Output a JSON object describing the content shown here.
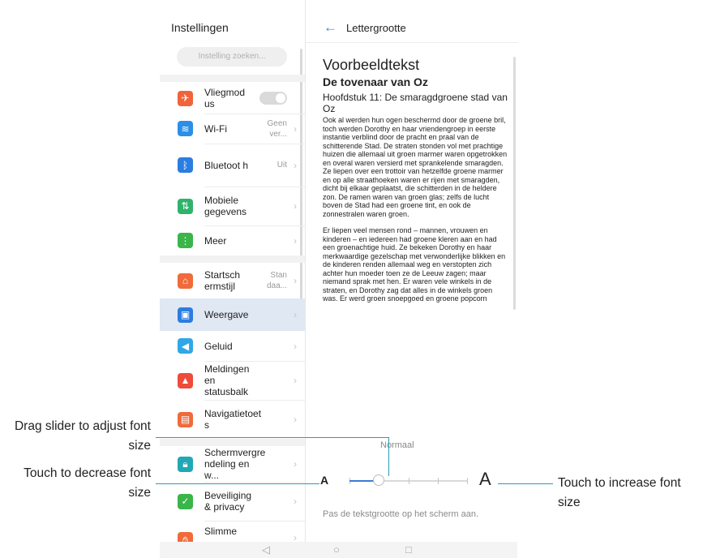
{
  "left_pane": {
    "title": "Instellingen",
    "search_placeholder": "Instelling zoeken...",
    "items": [
      {
        "label": "Vliegmod us",
        "value": "",
        "icon": "airplane-icon",
        "color": "#f0643c"
      },
      {
        "label": "Wi-Fi",
        "value": "Geen ver...",
        "icon": "wifi-icon",
        "color": "#2b8fe8"
      },
      {
        "label": "Bluetoot h",
        "value": "Uit",
        "icon": "bluetooth-icon",
        "color": "#2b7de0"
      },
      {
        "label": "Mobiele gegevens",
        "value": "",
        "icon": "mobile-data-icon",
        "color": "#2fb36b"
      },
      {
        "label": "Meer",
        "value": "",
        "icon": "more-icon",
        "color": "#39b54a"
      },
      {
        "label": "Startsch ermstijl",
        "value": "Stan daa...",
        "icon": "home-icon",
        "color": "#f06a3a"
      },
      {
        "label": "Weergave",
        "value": "",
        "icon": "display-icon",
        "color": "#2b7de0"
      },
      {
        "label": "Geluid",
        "value": "",
        "icon": "sound-icon",
        "color": "#30a7e6"
      },
      {
        "label": "Meldingen en statusbalk",
        "value": "",
        "icon": "notifications-icon",
        "color": "#ef4b3a"
      },
      {
        "label": "Navigatietoet s",
        "value": "",
        "icon": "navigation-keys-icon",
        "color": "#f06a3a"
      },
      {
        "label": "Schermvergre ndeling en w...",
        "value": "",
        "icon": "lock-icon",
        "color": "#21a7b5"
      },
      {
        "label": "Beveiliging & privacy",
        "value": "",
        "icon": "shield-icon",
        "color": "#39b54a"
      },
      {
        "label": "Slimme",
        "value": "",
        "icon": "hand-icon",
        "color": "#f06a3a"
      }
    ]
  },
  "right_pane": {
    "title": "Lettergrootte",
    "preview_heading": "Voorbeeldtekst",
    "book_title": "De tovenaar van Oz",
    "chapter": "Hoofdstuk 11: De smaragdgroene stad van Oz",
    "paragraph1": "Ook al werden hun ogen beschermd door de groene bril, toch werden Dorothy en haar vriendengroep in eerste instantie verblind door de pracht en praal van de schitterende Stad. De straten stonden vol met prachtige huizen die allemaal uit groen marmer waren opgetrokken en overal waren versierd met sprankelende smaragden. Ze liepen over een trottoir van hetzelfde groene marmer en op alle straathoeken waren er rijen met smaragden, dicht bij elkaar geplaatst, die schitterden in de heldere zon. De ramen waren van groen glas; zelfs de lucht boven de Stad had een groene tint, en ook de zonnestralen waren groen.",
    "paragraph2": "Er liepen veel mensen rond – mannen, vrouwen en kinderen – en iedereen had groene kleren aan en had een groenachtige huid. Ze bekeken Dorothy en haar merkwaardige gezelschap met verwonderlijke blikken en de kinderen renden allemaal weg en verstopten zich achter hun moeder toen ze de Leeuw zagen; maar niemand sprak met hen. Er waren vele winkels in de straten, en Dorothy zag dat alles in de winkels groen was. Er werd groen snoepgoed en groene popcorn",
    "size_label": "Normaal",
    "decrease_label": "A",
    "increase_label": "A",
    "slider_level_fraction": 0.25,
    "slider_steps": 5,
    "hint": "Pas de tekstgrootte op het scherm aan."
  },
  "navbar": {
    "back": "◁",
    "home": "○",
    "recents": "□"
  },
  "annotations": {
    "drag_slider": "Drag slider to adjust font size",
    "decrease": "Touch to decrease font size",
    "increase": "Touch to increase font size"
  },
  "colors": {
    "accent": "#3a7bd5",
    "callout_line": "#2a9fb3"
  }
}
